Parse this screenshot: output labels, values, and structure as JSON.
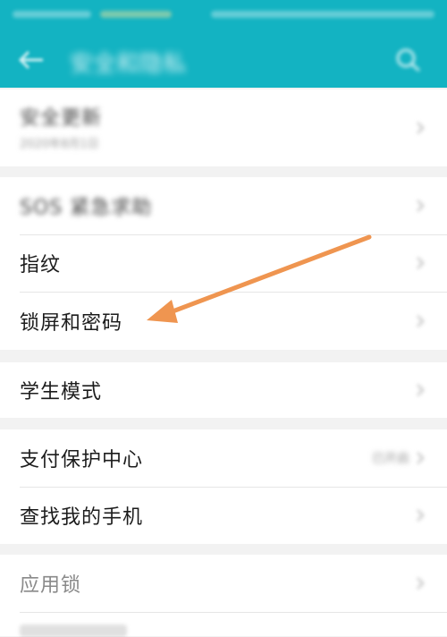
{
  "header": {
    "title": "安全和隐私"
  },
  "items": {
    "security_update": {
      "label": "安全更新",
      "date": "2020年8月1日"
    },
    "sos": {
      "label": "SOS 紧急求助"
    },
    "fingerprint": {
      "label": "指纹"
    },
    "lock_screen": {
      "label": "锁屏和密码"
    },
    "student_mode": {
      "label": "学生模式"
    },
    "payment": {
      "label": "支付保护中心",
      "value": "已开启"
    },
    "find_phone": {
      "label": "查找我的手机"
    },
    "app_lock": {
      "label": "应用锁"
    }
  },
  "colors": {
    "appbar": "#13b3c2",
    "arrow": "#ef9550"
  }
}
